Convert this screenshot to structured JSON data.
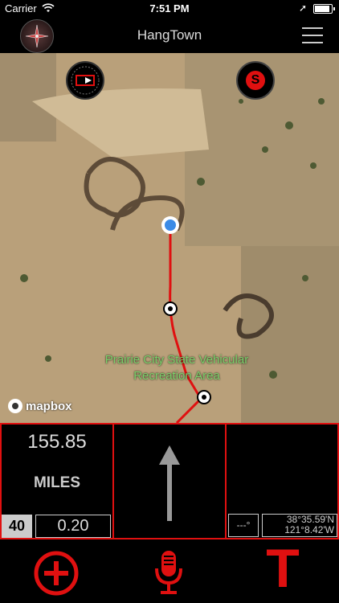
{
  "status": {
    "carrier": "Carrier",
    "time": "7:51 PM",
    "battery_level": 0.9
  },
  "nav": {
    "title": "HangTown"
  },
  "map": {
    "label_line1": "Prairie City State Vehicular",
    "label_line2": "Recreation Area",
    "attribution": "mapbox"
  },
  "panels": {
    "distance": "155.85",
    "units": "MILES",
    "speed": "40",
    "trip": "0.20",
    "heading": "---°",
    "lat": "38°35.59'N",
    "lon": "121°8.42'W"
  },
  "toolbar": {
    "t_label": "T"
  },
  "colors": {
    "accent": "#e01010",
    "route": "#e01010",
    "location": "#3b8be6"
  }
}
